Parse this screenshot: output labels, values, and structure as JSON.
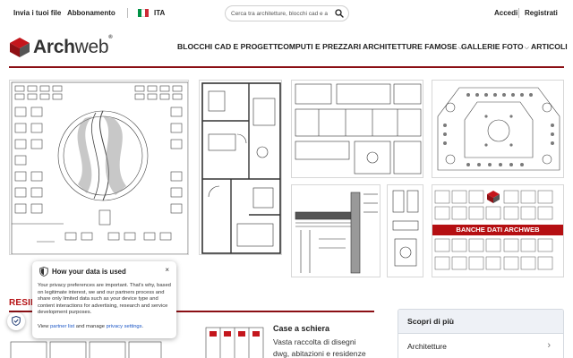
{
  "topbar": {
    "upload_label": "Invia i tuoi file",
    "subscription_label": "Abbonamento",
    "language_label": "ITA",
    "flag_colors": [
      "#009246",
      "#ffffff",
      "#ce2b37"
    ],
    "search_placeholder": "Cerca tra architetture, blocchi cad e altro",
    "login_label": "Accedi",
    "register_label": "Registrati"
  },
  "header": {
    "logo_text_bold": "Arch",
    "logo_text_light": "web",
    "logo_reg": "®",
    "nav": [
      {
        "label": "BLOCCHI CAD E PROGETTI",
        "has_dropdown": false
      },
      {
        "label": "COMPUTI E PREZZARI",
        "has_dropdown": false
      },
      {
        "label": "ARCHITETTURE FAMOSE",
        "has_dropdown": true
      },
      {
        "label": "GALLERIE FOTO",
        "has_dropdown": true
      },
      {
        "label": "ARTICOLI",
        "has_dropdown": false
      }
    ],
    "chevron": "⌵"
  },
  "gallery": {
    "banner_text": "BANCHE DATI ARCHWEB"
  },
  "section": {
    "title": "RESIDENZE"
  },
  "card": {
    "title": "Case a schiera",
    "text": "Vasta raccolta di disegni dwg, abitazioni e residenze"
  },
  "sidebar": {
    "title": "Scopri di più",
    "items": [
      {
        "label": "Architetture"
      }
    ],
    "arrow": "›"
  },
  "privacy": {
    "title": "How your data is used",
    "close": "×",
    "body": "Your privacy preferences are important. That's why, based on legitimate interest, we and our partners process and share only limited data such as your device type and content interactions for advertising, research and service development purposes.",
    "foot_prefix": "View ",
    "partner_link": "partner list",
    "foot_middle": " and manage ",
    "privacy_link": "privacy settings",
    "foot_suffix": "."
  },
  "colors": {
    "brand_red": "#b50f12",
    "rule_red": "#8b0f14",
    "link_blue": "#1a55c5"
  }
}
